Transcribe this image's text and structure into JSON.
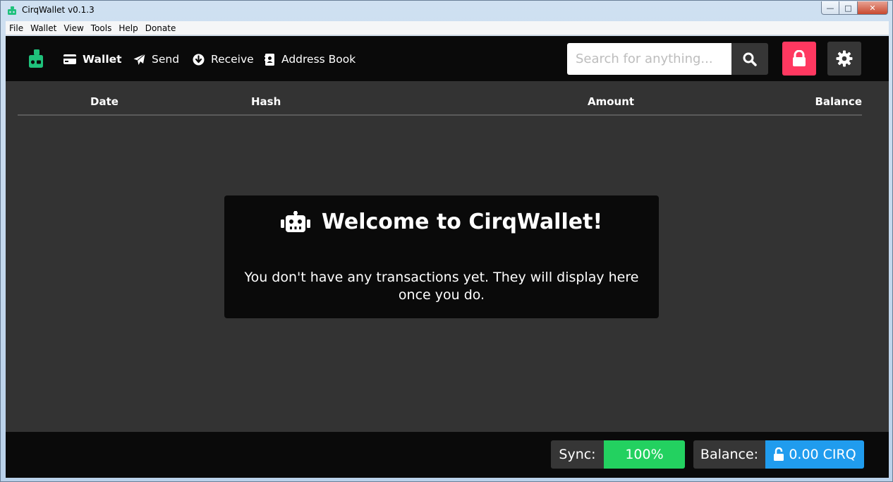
{
  "window": {
    "title": "CirqWallet v0.1.3",
    "min_glyph": "—",
    "max_glyph": "□",
    "close_glyph": "✕"
  },
  "menu": [
    "File",
    "Wallet",
    "View",
    "Tools",
    "Help",
    "Donate"
  ],
  "nav": {
    "wallet": "Wallet",
    "send": "Send",
    "receive": "Receive",
    "address_book": "Address Book"
  },
  "search": {
    "placeholder": "Search for anything..."
  },
  "table": {
    "columns": [
      "Date",
      "Hash",
      "Amount",
      "Balance"
    ]
  },
  "welcome": {
    "title": "Welcome to CirqWallet!",
    "message": "You don't have any transactions yet. They will display here once you do."
  },
  "status": {
    "sync_label": "Sync:",
    "sync_value": "100%",
    "balance_label": "Balance:",
    "balance_value": "0.00 CIRQ"
  },
  "colors": {
    "brand": "#1fc17b",
    "lock": "#ff3860",
    "sync": "#23d160",
    "balance": "#209cee"
  }
}
